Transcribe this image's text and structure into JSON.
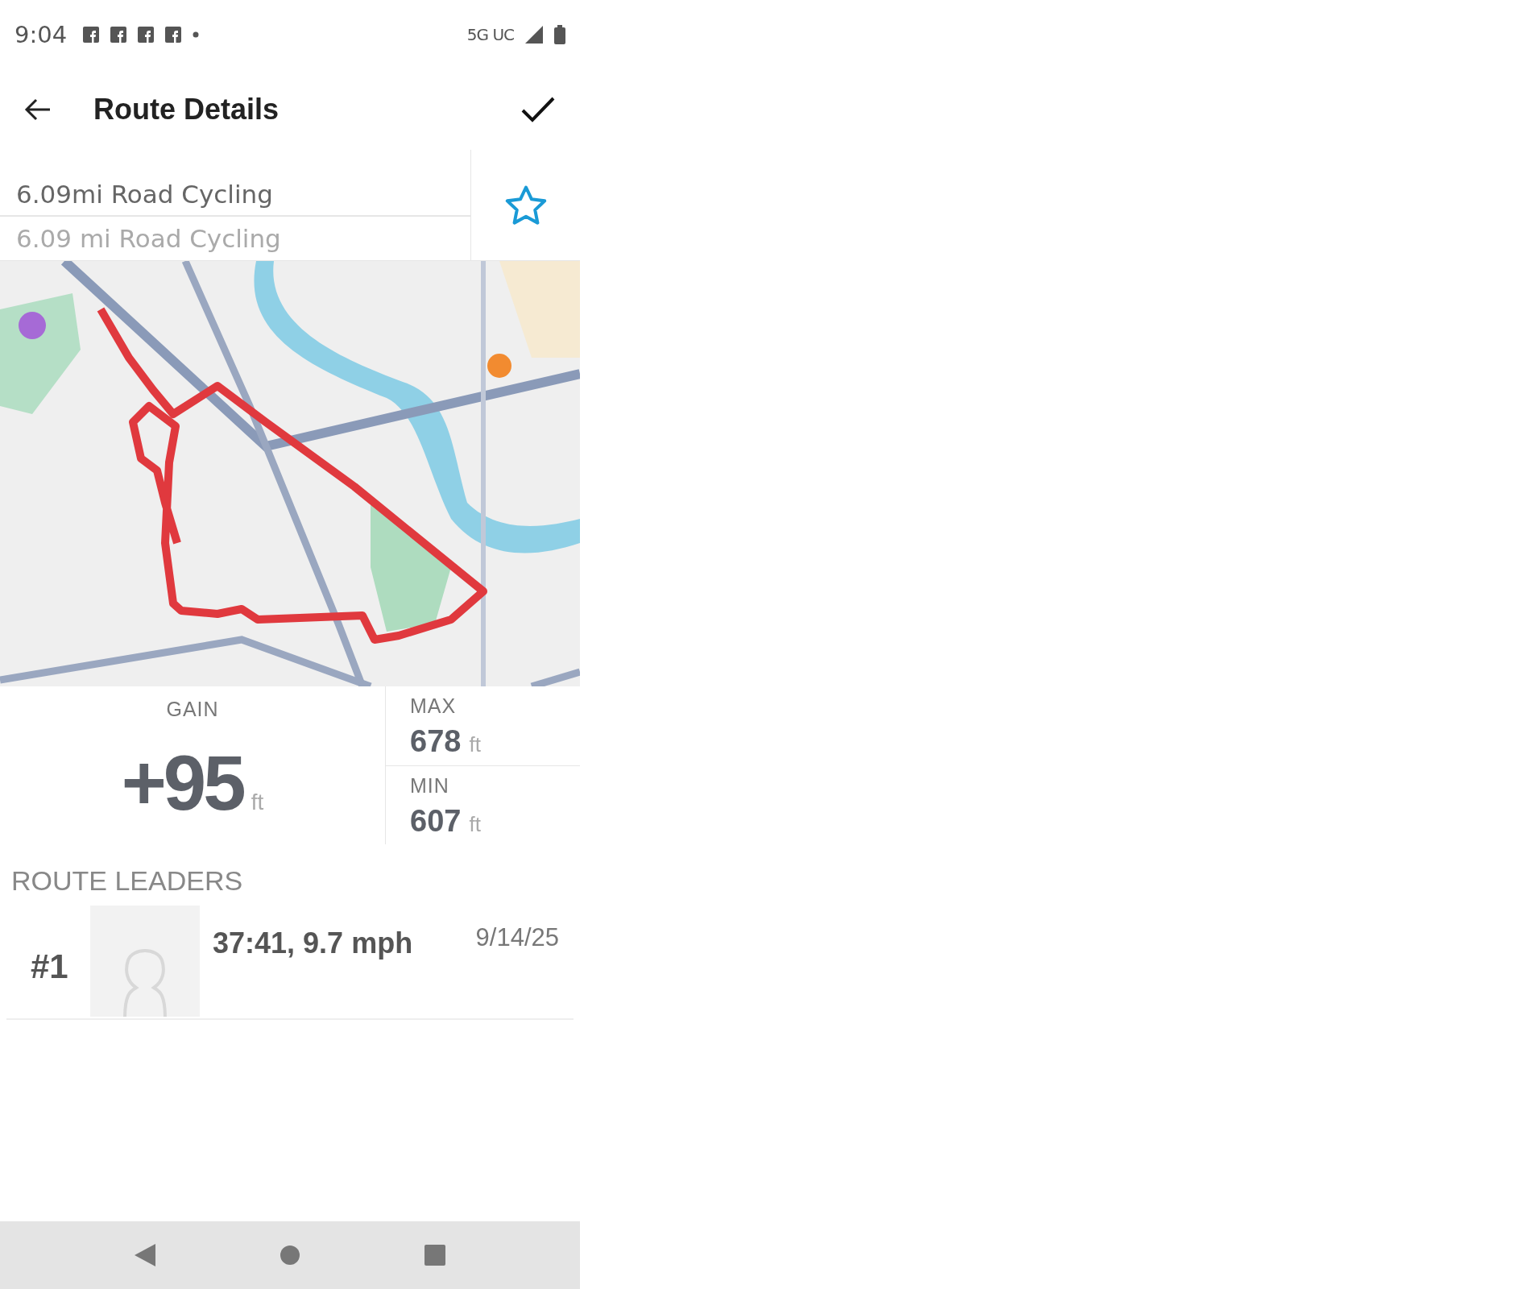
{
  "status_bar": {
    "time": "9:04",
    "network": "5G UC"
  },
  "header": {
    "title": "Route Details"
  },
  "name_field": {
    "value": "6.09mi Road Cycling"
  },
  "description_field": {
    "placeholder": "6.09 mi Road Cycling"
  },
  "favorite": {
    "starred": false
  },
  "elevation": {
    "gain": {
      "label": "GAIN",
      "value": "+95",
      "unit": "ft"
    },
    "max": {
      "label": "MAX",
      "value": "678",
      "unit": "ft"
    },
    "min": {
      "label": "MIN",
      "value": "607",
      "unit": "ft"
    }
  },
  "route_leaders": {
    "title": "ROUTE LEADERS",
    "rows": [
      {
        "rank": "#1",
        "result": "37:41, 9.7 mph",
        "date": "9/14/25"
      }
    ]
  }
}
